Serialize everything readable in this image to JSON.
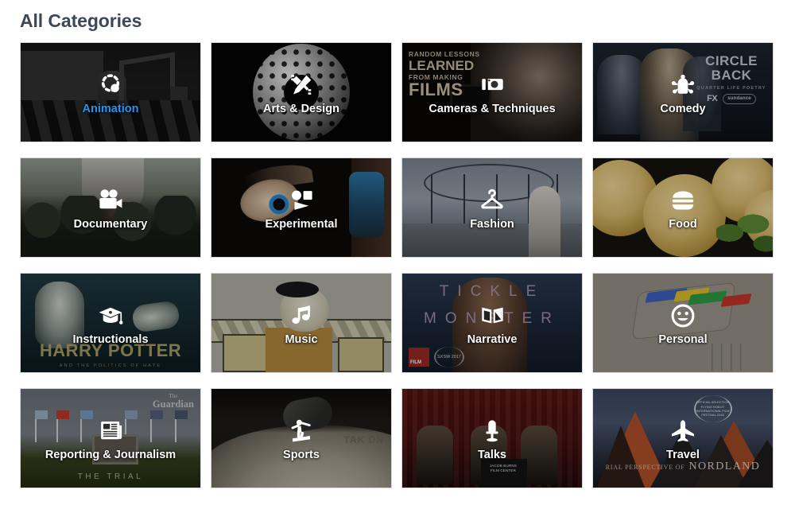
{
  "header": {
    "title": "All Categories",
    "title_color": "#3c4858"
  },
  "theme": {
    "background": "#ffffff",
    "label_color": "#ffffff",
    "active_label_color": "#2196f3",
    "tile_border": "#d8d8d8"
  },
  "grid": {
    "columns": 4,
    "rows": 4,
    "tile_count": 16
  },
  "categories": [
    {
      "label": "Animation",
      "icon": "animation-motion-path-icon",
      "active": true,
      "artwork_text": []
    },
    {
      "label": "Arts & Design",
      "icon": "pencil-ruler-icon",
      "active": false,
      "artwork_text": []
    },
    {
      "label": "Cameras & Techniques",
      "icon": "camera-icon",
      "active": false,
      "artwork_text": [
        "RANDOM LESSONS",
        "LEARNED",
        "FROM MAKING",
        "FILMS"
      ]
    },
    {
      "label": "Comedy",
      "icon": "jester-hat-icon",
      "active": false,
      "artwork_text": [
        "CIRCLE",
        "BACK",
        "QUARTER LIFE POETRY",
        "FX",
        "sundance"
      ]
    },
    {
      "label": "Documentary",
      "icon": "film-camera-icon",
      "active": false,
      "artwork_text": []
    },
    {
      "label": "Experimental",
      "icon": "abstract-shapes-icon",
      "active": false,
      "artwork_text": []
    },
    {
      "label": "Fashion",
      "icon": "clothes-hanger-icon",
      "active": false,
      "artwork_text": []
    },
    {
      "label": "Food",
      "icon": "burger-icon",
      "active": false,
      "artwork_text": []
    },
    {
      "label": "Instructionals",
      "icon": "graduation-cap-icon",
      "active": false,
      "artwork_text": [
        "HARRY POTTER",
        "AND THE POLITICS OF HATE"
      ]
    },
    {
      "label": "Music",
      "icon": "music-note-icon",
      "active": false,
      "artwork_text": []
    },
    {
      "label": "Narrative",
      "icon": "open-book-icon",
      "active": false,
      "artwork_text": [
        "TICKLE",
        "MONSTER",
        "FILM",
        "SXSW 2017"
      ]
    },
    {
      "label": "Personal",
      "icon": "smiley-face-icon",
      "active": false,
      "artwork_text": []
    },
    {
      "label": "Reporting & Journalism",
      "icon": "newspaper-icon",
      "active": false,
      "artwork_text": [
        "The",
        "Guardian",
        "THE TRIAL"
      ]
    },
    {
      "label": "Sports",
      "icon": "snowboarder-icon",
      "active": false,
      "artwork_text": [
        "TAK DN"
      ]
    },
    {
      "label": "Talks",
      "icon": "microphone-stand-icon",
      "active": false,
      "artwork_text": [
        "JACOB BURNS FILM CENTER"
      ]
    },
    {
      "label": "Travel",
      "icon": "airplane-icon",
      "active": false,
      "artwork_text": [
        "RIAL PERSPECTIVE OF",
        "NORDLAND",
        "OFFICIAL SELECTION FLYING ROBOT INTERNATIONAL FILM FESTIVAL 2016"
      ]
    }
  ]
}
